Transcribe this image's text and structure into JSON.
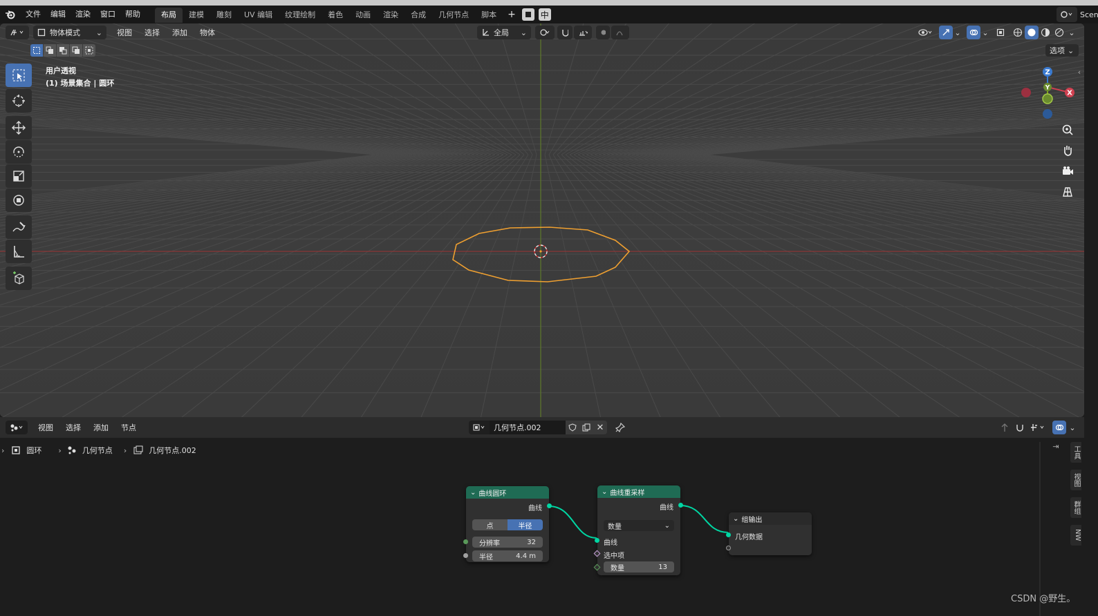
{
  "menubar": {
    "items": [
      "文件",
      "编辑",
      "渲染",
      "窗口",
      "帮助"
    ],
    "workspaces": [
      "布局",
      "建模",
      "雕刻",
      "UV 编辑",
      "纹理绘制",
      "着色",
      "动画",
      "渲染",
      "合成",
      "几何节点",
      "脚本"
    ],
    "add_tab": "+",
    "ime_label": "中",
    "scene_label": "Scen"
  },
  "viewport": {
    "mode": "物体模式",
    "menus": [
      "视图",
      "选择",
      "添加",
      "物体"
    ],
    "transform_orientation": "全局",
    "options_label": "选项",
    "view_name": "用户透视",
    "collection_info": "(1) 场景集合 | 圆环",
    "gizmo": {
      "z": "Z",
      "y": "Y",
      "x": "X"
    },
    "accent": "#4772b3",
    "selection_color": "#f0a030"
  },
  "node_editor": {
    "menus": [
      "视图",
      "选择",
      "添加",
      "节点"
    ],
    "node_group_name": "几何节点.002",
    "breadcrumb": [
      "圆环",
      "几何节点",
      "几何节点.002"
    ],
    "side_tabs": [
      "工具",
      "视图",
      "群组",
      "NW"
    ],
    "nodes": {
      "curve_circle": {
        "title": "曲线圆环",
        "output": "曲线",
        "mode_options": [
          "点",
          "半径"
        ],
        "mode_selected": "半径",
        "resolution_label": "分辨率",
        "resolution_value": "32",
        "radius_label": "半径",
        "radius_value": "4.4 m"
      },
      "resample": {
        "title": "曲线重采样",
        "output": "曲线",
        "mode": "数量",
        "input_curve": "曲线",
        "input_selection": "选中项",
        "count_label": "数量",
        "count_value": "13"
      },
      "group_output": {
        "title": "组输出",
        "input": "几何数据"
      }
    },
    "header_color": "#1f6b54",
    "link_color": "#00d6a3"
  },
  "watermark": "CSDN @野生。"
}
